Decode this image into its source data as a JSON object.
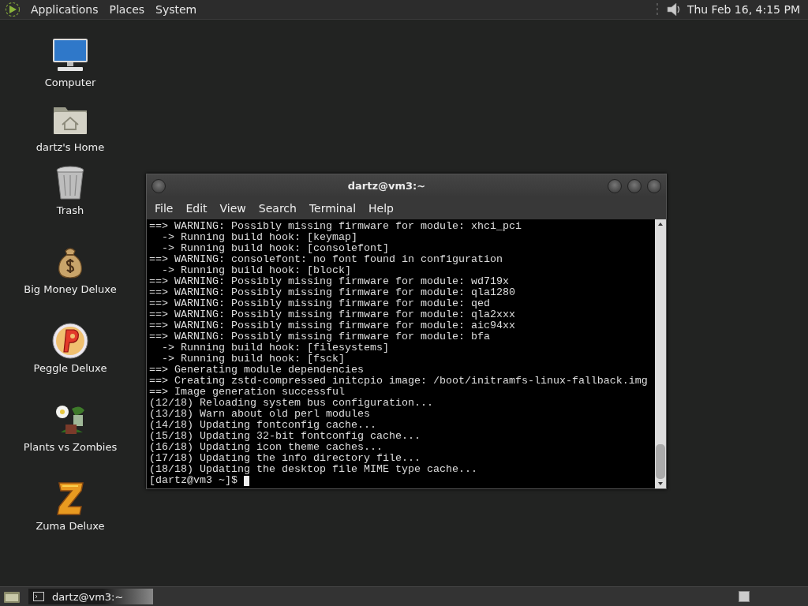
{
  "top_panel": {
    "menus": [
      "Applications",
      "Places",
      "System"
    ],
    "clock": "Thu Feb 16,  4:15 PM"
  },
  "desktop_icons": [
    {
      "label": "Computer",
      "kind": "computer"
    },
    {
      "label": "dartz's Home",
      "kind": "home"
    },
    {
      "label": "Trash",
      "kind": "trash"
    },
    {
      "label": "Big Money Deluxe",
      "kind": "money"
    },
    {
      "label": "Peggle Deluxe",
      "kind": "peggle"
    },
    {
      "label": "Plants vs Zombies",
      "kind": "plants"
    },
    {
      "label": "Zuma Deluxe",
      "kind": "zuma"
    }
  ],
  "terminal_window": {
    "title": "dartz@vm3:~",
    "menus": [
      "File",
      "Edit",
      "View",
      "Search",
      "Terminal",
      "Help"
    ],
    "lines": [
      "==> WARNING: Possibly missing firmware for module: xhci_pci",
      "  -> Running build hook: [keymap]",
      "  -> Running build hook: [consolefont]",
      "==> WARNING: consolefont: no font found in configuration",
      "  -> Running build hook: [block]",
      "==> WARNING: Possibly missing firmware for module: wd719x",
      "==> WARNING: Possibly missing firmware for module: qla1280",
      "==> WARNING: Possibly missing firmware for module: qed",
      "==> WARNING: Possibly missing firmware for module: qla2xxx",
      "==> WARNING: Possibly missing firmware for module: aic94xx",
      "==> WARNING: Possibly missing firmware for module: bfa",
      "  -> Running build hook: [filesystems]",
      "  -> Running build hook: [fsck]",
      "==> Generating module dependencies",
      "==> Creating zstd-compressed initcpio image: /boot/initramfs-linux-fallback.img",
      "==> Image generation successful",
      "(12/18) Reloading system bus configuration...",
      "(13/18) Warn about old perl modules",
      "(14/18) Updating fontconfig cache...",
      "(15/18) Updating 32-bit fontconfig cache...",
      "(16/18) Updating icon theme caches...",
      "(17/18) Updating the info directory file...",
      "(18/18) Updating the desktop file MIME type cache..."
    ],
    "prompt": "[dartz@vm3 ~]$"
  },
  "taskbar": {
    "windows": [
      {
        "title": "dartz@vm3:~",
        "selected": true
      }
    ]
  }
}
